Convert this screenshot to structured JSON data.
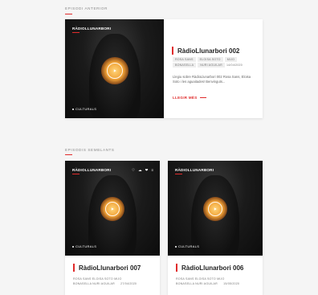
{
  "sections": {
    "previous_title": "EPISODI ANTERIOR",
    "similar_title": "EPISODIS SEMBLANTS"
  },
  "brand": "RÀDIOLLUNARBORI",
  "featured": {
    "title": "RàdioLlunarbori 002",
    "tags": [
      "ROSA SANS",
      "ELOISA SOTO",
      "MIJO",
      "BONASELLA",
      "NURI AGUILAR"
    ],
    "date": "14/04/2020",
    "description": "Llegiu sobre RàdioLlunarbori 002 Rosa Sans, Eloisa Soto i les aguaitades! Benvinguts...",
    "read_more": "LLEGIR MÉS",
    "category": "CULTURALS"
  },
  "similar": [
    {
      "title": "RàdioLlunarbori 007",
      "tags_line1": "ROSA SANS  ELOISA SOTO  MIJO",
      "tags_line2": "BONASELLA  NURI AGUILAR",
      "date": "27/04/2020",
      "category": "CULTURALS",
      "icons": [
        "♡",
        "☁",
        "❤",
        "≡"
      ]
    },
    {
      "title": "RàdioLlunarbori 006",
      "tags_line1": "ROSA SANS  ELOISA SOTO  MIJO",
      "tags_line2": "BONASELLA  NURI AGUILAR",
      "date": "15/05/2020",
      "category": "CULTURALS"
    }
  ]
}
